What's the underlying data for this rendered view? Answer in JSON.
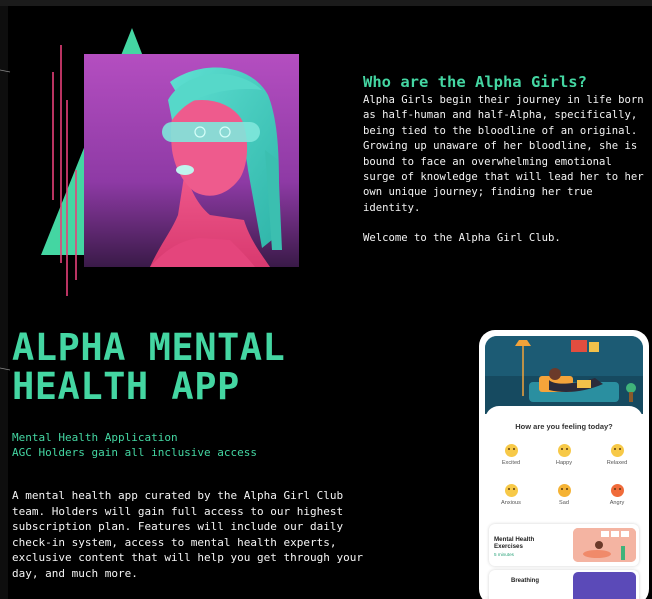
{
  "about": {
    "heading": "Who are the Alpha Girls?",
    "body": "Alpha Girls begin their journey in life born as half-human and half-Alpha, specifically, being tied to the bloodline of an original. Growing up unaware of her bloodline, she is bound to face an overwhelming emotional surge of knowledge that will lead her to her own unique journey; finding her true identity.",
    "welcome": "Welcome to the Alpha Girl Club."
  },
  "app_section": {
    "title_line1": "ALPHA MENTAL",
    "title_line2": "HEALTH APP",
    "subtitle_line1": "Mental Health Application",
    "subtitle_line2": "AGC Holders gain all inclusive access",
    "description": "A mental health app curated by the Alpha Girl Club team. Holders will gain full access to our highest subscription plan. Features will include our daily check-in system, access to mental health experts, exclusive content that will help you get through your day, and much more."
  },
  "phone": {
    "question": "How are you feeling today?",
    "moods": [
      {
        "label": "Excited",
        "color": "#f7c948"
      },
      {
        "label": "Happy",
        "color": "#f7c948"
      },
      {
        "label": "Relaxed",
        "color": "#f7c948"
      },
      {
        "label": "Anxious",
        "color": "#f7c948"
      },
      {
        "label": "Sad",
        "color": "#f5b335"
      },
      {
        "label": "Angry",
        "color": "#f06b3a"
      }
    ],
    "exercise_card": {
      "title": "Mental Health Exercises",
      "duration": "5 minutes"
    },
    "breathing_card": {
      "title": "Breathing"
    }
  },
  "colors": {
    "accent": "#44d6a2",
    "background": "#000000",
    "pink": "#e8407a",
    "purple": "#8b3a9e"
  }
}
